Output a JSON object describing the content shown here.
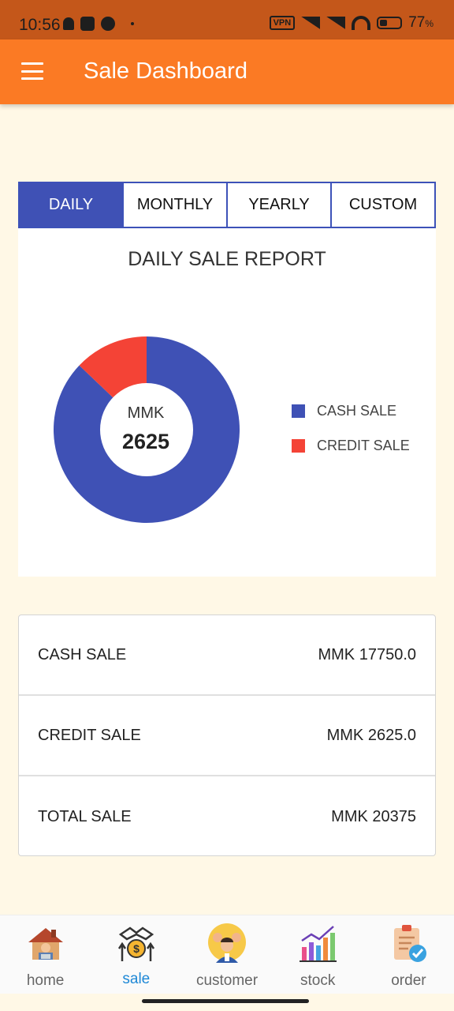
{
  "status_bar": {
    "time": "10:56",
    "vpn": "VPN",
    "battery_percent": "77",
    "battery_sign": "%"
  },
  "app_bar": {
    "title": "Sale Dashboard"
  },
  "tabs": [
    {
      "label": "DAILY",
      "active": true
    },
    {
      "label": "MONTHLY",
      "active": false
    },
    {
      "label": "YEARLY",
      "active": false
    },
    {
      "label": "CUSTOM",
      "active": false
    }
  ],
  "report": {
    "title": "DAILY SALE REPORT",
    "center_unit": "MMK",
    "center_value": "2625"
  },
  "chart_data": {
    "type": "pie",
    "categories": [
      "CASH SALE",
      "CREDIT SALE"
    ],
    "values": [
      17750,
      2625
    ],
    "colors": [
      "#3f51b5",
      "#f44336"
    ],
    "donut": true,
    "legend_position": "right"
  },
  "summary": [
    {
      "label": "CASH SALE",
      "value": "MMK 17750.0"
    },
    {
      "label": "CREDIT SALE",
      "value": "MMK 2625.0"
    },
    {
      "label": "TOTAL SALE",
      "value": "MMK 20375"
    }
  ],
  "bottom_nav": [
    {
      "label": "home",
      "icon": "home-icon",
      "active": false
    },
    {
      "label": "sale",
      "icon": "sale-icon",
      "active": true
    },
    {
      "label": "customer",
      "icon": "customer-icon",
      "active": false
    },
    {
      "label": "stock",
      "icon": "stock-icon",
      "active": false
    },
    {
      "label": "order",
      "icon": "order-icon",
      "active": false
    }
  ]
}
